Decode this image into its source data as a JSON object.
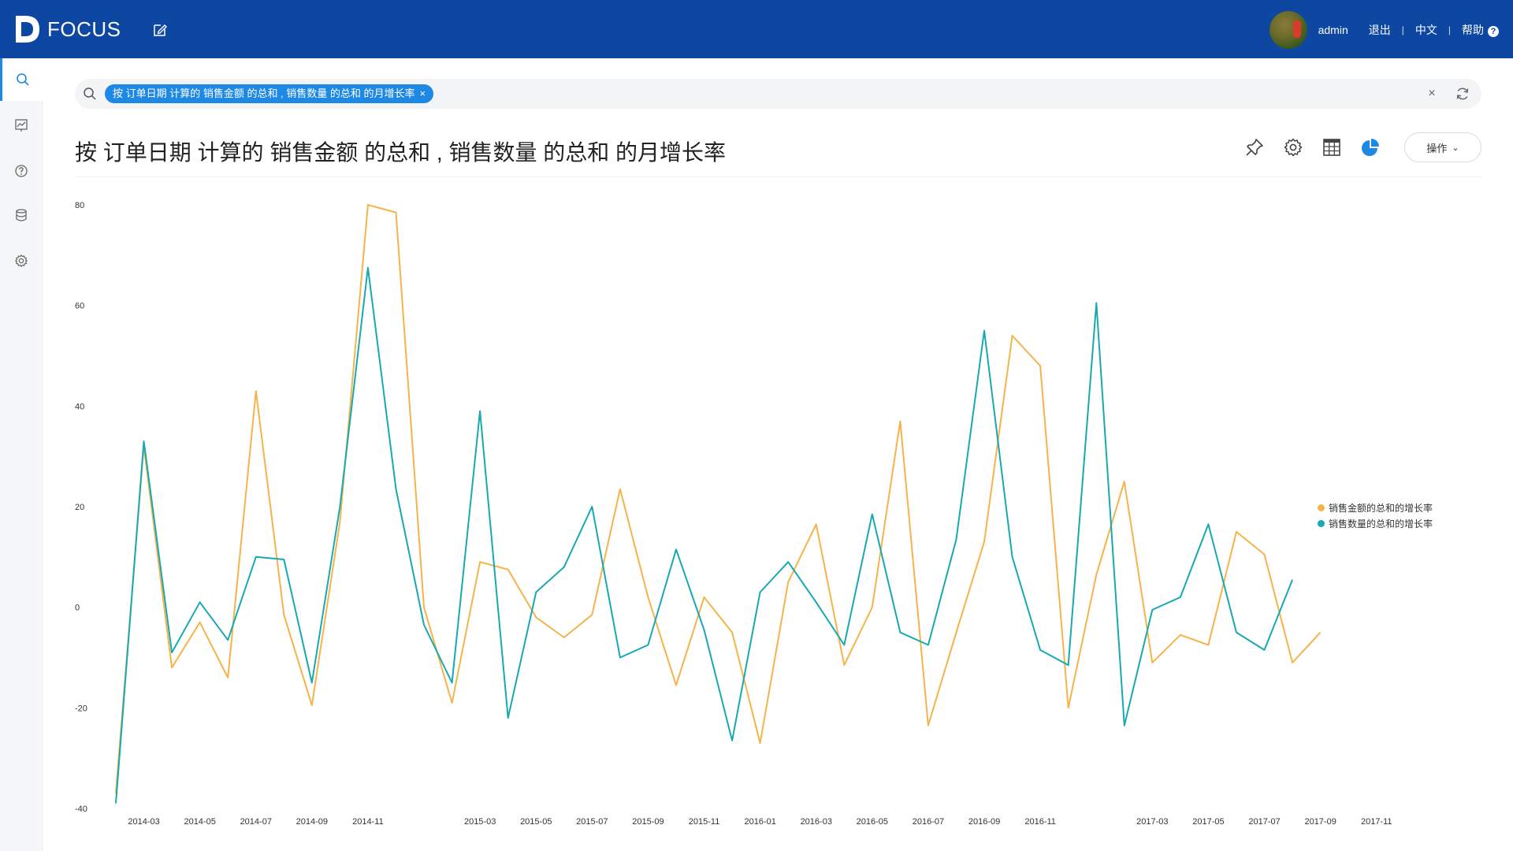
{
  "app": {
    "logo_text": "FOCUS",
    "brand_color": "#0d47a1",
    "accent_color": "#1e88e5"
  },
  "user": {
    "name": "admin",
    "logout": "退出",
    "language": "中文",
    "help": "帮助",
    "help_glyph": "?"
  },
  "sidebar": {
    "items": [
      {
        "icon": "search-icon",
        "active": true
      },
      {
        "icon": "board-icon",
        "active": false
      },
      {
        "icon": "question-icon",
        "active": false
      },
      {
        "icon": "database-icon",
        "active": false
      },
      {
        "icon": "gear-icon",
        "active": false
      }
    ]
  },
  "search": {
    "chip_label": "按 订单日期 计算的 销售金额 的总和 , 销售数量 的总和 的月增长率",
    "chip_close": "×",
    "clear_glyph": "×"
  },
  "page": {
    "title": "按 订单日期 计算的 销售金额 的总和 , 销售数量 的总和 的月增长率",
    "ops_label": "操作",
    "ops_chevron": "⌄"
  },
  "toolbar_icons": [
    "pin-icon",
    "gear-icon",
    "table-icon",
    "pie-chart-icon"
  ],
  "chart_data": {
    "type": "line",
    "title": "",
    "xlabel": "",
    "ylabel": "",
    "ylim": [
      -40,
      80
    ],
    "yticks": [
      80,
      60,
      40,
      20,
      0,
      -20,
      -40
    ],
    "grid": false,
    "legend_position": "right",
    "x": [
      "2014-02",
      "2014-03",
      "2014-04",
      "2014-05",
      "2014-06",
      "2014-07",
      "2014-08",
      "2014-09",
      "2014-10",
      "2014-11",
      "2014-12",
      "2015-01",
      "2015-02",
      "2015-03",
      "2015-04",
      "2015-05",
      "2015-06",
      "2015-07",
      "2015-08",
      "2015-09",
      "2015-10",
      "2015-11",
      "2015-12",
      "2016-01",
      "2016-02",
      "2016-03",
      "2016-04",
      "2016-05",
      "2016-06",
      "2016-07",
      "2016-08",
      "2016-09",
      "2016-10",
      "2016-11",
      "2016-12",
      "2017-01",
      "2017-02",
      "2017-03",
      "2017-04",
      "2017-05",
      "2017-06",
      "2017-07",
      "2017-08",
      "2017-09",
      "2017-10",
      "2017-11",
      "2017-12"
    ],
    "xtick_labels": [
      "2014-03",
      "2014-05",
      "2014-07",
      "2014-09",
      "2014-11",
      "2015-03",
      "2015-05",
      "2015-07",
      "2015-09",
      "2015-11",
      "2016-01",
      "2016-03",
      "2016-05",
      "2016-07",
      "2016-09",
      "2016-11",
      "2017-03",
      "2017-05",
      "2017-07",
      "2017-09",
      "2017-11"
    ],
    "series": [
      {
        "name": "销售金额的总和的增长率",
        "color": "#f5b34a",
        "values": [
          -37,
          32,
          -12,
          -3,
          -14,
          43,
          -1.5,
          -19.5,
          17,
          80,
          78.5,
          0,
          -19,
          9,
          7.5,
          -2,
          -6,
          -1.5,
          23.5,
          2,
          -15.5,
          2,
          -5,
          -27,
          5,
          16.5,
          -11.5,
          0,
          37,
          -23.5,
          -5,
          13,
          54,
          48,
          -20,
          6.5,
          25,
          -11,
          -5.5,
          -7.5,
          15,
          10.5,
          -11,
          -5
        ]
      },
      {
        "name": "销售数量的总和的增长率",
        "color": "#17a9b3",
        "values": [
          -39,
          33,
          -9,
          1,
          -6.5,
          10,
          9.5,
          -15,
          20,
          67.5,
          23.5,
          -3.5,
          -15,
          39,
          -22,
          3,
          8,
          20,
          -10,
          -7.5,
          11.5,
          -4.5,
          -26.5,
          3,
          9,
          1,
          -7.5,
          18.5,
          -5,
          -7.5,
          13.5,
          55,
          10,
          -8.5,
          -11.5,
          60.5,
          -23.5,
          -0.5,
          2,
          16.5,
          -5,
          -8.5,
          5.5
        ]
      }
    ]
  }
}
